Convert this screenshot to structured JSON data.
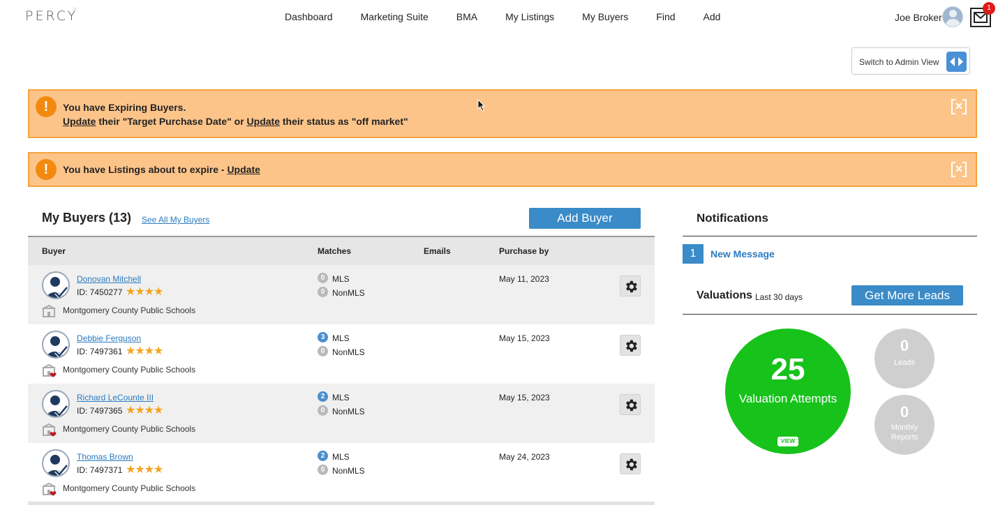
{
  "header": {
    "logo": "PERCY",
    "logo_sup": "AI",
    "nav": [
      "Dashboard",
      "Marketing Suite",
      "BMA",
      "My Listings",
      "My Buyers",
      "Find",
      "Add"
    ],
    "user_name": "Joe Broker",
    "mail_count": "1",
    "icons": {
      "avatar": "user-avatar",
      "mail": "envelope-icon"
    }
  },
  "admin_switch": {
    "label": "Switch to Admin View",
    "icon": "toggle-arrows-icon"
  },
  "alerts": {
    "expiring_buyers": {
      "line1": "You have Expiring Buyers.",
      "link1": "Update",
      "mid": " their \"Target Purchase Date\" or ",
      "link2": "Update",
      "end": " their status as \"off market\""
    },
    "expiring_listings": {
      "text": "You have Listings about to expire - ",
      "link": "Update"
    },
    "accent": "#fdc48a",
    "border": "#f5a33c"
  },
  "buyers": {
    "title": "My Buyers (13)",
    "see_all": "See All My Buyers",
    "add_button": "Add Buyer",
    "columns": [
      "Buyer",
      "Matches",
      "Emails",
      "Purchase by"
    ],
    "rows": [
      {
        "name": "Donovan Mitchell",
        "id": "ID: 7450277",
        "stars": "★★★★",
        "school": "Montgomery County Public Schools",
        "mls": "0",
        "mls_label": "MLS",
        "nonmls": "0",
        "nonmls_label": "NonMLS",
        "date": "May 11, 2023",
        "favorite": false
      },
      {
        "name": "Debbie Ferguson",
        "id": "ID: 7497361",
        "stars": "★★★★",
        "school": "Montgomery County Public Schools",
        "mls": "3",
        "mls_label": "MLS",
        "nonmls": "0",
        "nonmls_label": "NonMLS",
        "date": "May 15, 2023",
        "favorite": true
      },
      {
        "name": "Richard LeCounte III",
        "id": "ID: 7497365",
        "stars": "★★★★",
        "school": "Montgomery County Public Schools",
        "mls": "2",
        "mls_label": "MLS",
        "nonmls": "0",
        "nonmls_label": "NonMLS",
        "date": "May 15, 2023",
        "favorite": true
      },
      {
        "name": "Thomas Brown",
        "id": "ID: 7497371",
        "stars": "★★★★",
        "school": "Montgomery County Public Schools",
        "mls": "2",
        "mls_label": "MLS",
        "nonmls": "0",
        "nonmls_label": "NonMLS",
        "date": "May 24, 2023",
        "favorite": true
      }
    ]
  },
  "notifications": {
    "title": "Notifications",
    "count": "1",
    "message": "New Message"
  },
  "valuations": {
    "title": "Valuations",
    "subtitle": "Last 30 days",
    "leads_button": "Get More Leads",
    "attempts": "25",
    "attempts_label": "Valuation Attempts",
    "view": "VIEW",
    "leads": "0",
    "leads_label": "Leads",
    "reports": "0",
    "reports_label": "Monthly Reports",
    "accent": "#17c21b"
  }
}
